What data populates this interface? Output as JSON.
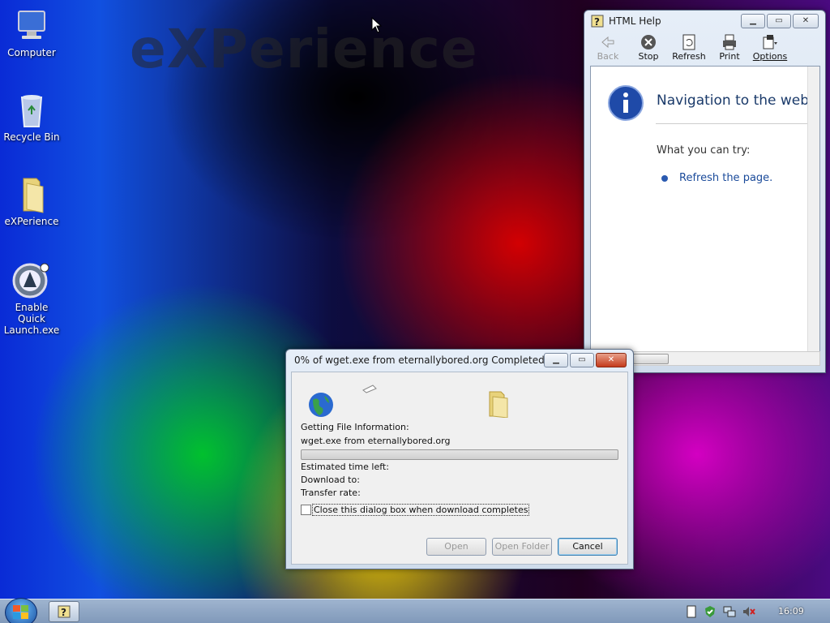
{
  "desktop": {
    "watermark": "eXPerience",
    "icons": [
      {
        "label": "Computer"
      },
      {
        "label": "Recycle Bin"
      },
      {
        "label": "eXPerience"
      },
      {
        "label": "Enable Quick Launch.exe"
      }
    ]
  },
  "help_window": {
    "title": "HTML Help",
    "toolbar": {
      "back": "Back",
      "stop": "Stop",
      "refresh": "Refresh",
      "print": "Print",
      "options": "Options"
    },
    "heading": "Navigation to the webp",
    "subheading": "What you can try:",
    "link": "Refresh the page."
  },
  "download_dialog": {
    "title": "0% of wget.exe from eternallybored.org Completed",
    "status_label": "Getting File Information:",
    "file_info": "wget.exe from eternallybored.org",
    "progress": 0,
    "est_time_label": "Estimated time left:",
    "download_to_label": "Download to:",
    "transfer_rate_label": "Transfer rate:",
    "close_checkbox_label": "Close this dialog box when download completes",
    "close_checkbox_checked": false,
    "open_button": "Open",
    "open_folder_button": "Open Folder",
    "cancel_button": "Cancel"
  },
  "taskbar": {
    "clock": "16:09"
  }
}
